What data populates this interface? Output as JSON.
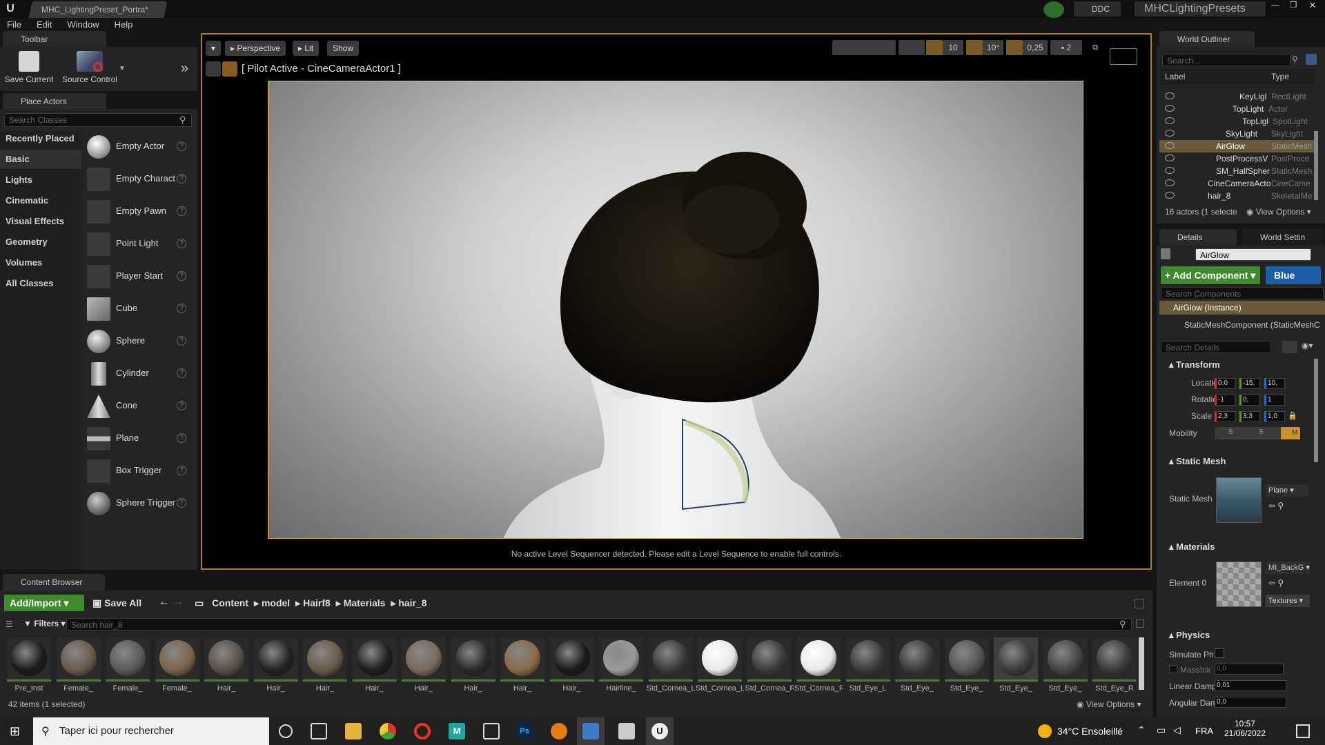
{
  "titlebar": {
    "doc_tab": "MHC_LightingPreset_Portra*",
    "ddc_label": "DDC",
    "project_name": "MHCLightingPresets"
  },
  "menu": [
    "File",
    "Edit",
    "Window",
    "Help"
  ],
  "toolbar": {
    "tab_label": "Toolbar",
    "save_current": "Save Current",
    "source_control": "Source Control"
  },
  "place_actors": {
    "tab_label": "Place Actors",
    "search_placeholder": "Search Classes",
    "categories": [
      "Recently Placed",
      "Basic",
      "Lights",
      "Cinematic",
      "Visual Effects",
      "Geometry",
      "Volumes",
      "All Classes"
    ],
    "active_category": "Basic",
    "actors": [
      "Empty Actor",
      "Empty Charact",
      "Empty Pawn",
      "Point Light",
      "Player Start",
      "Cube",
      "Sphere",
      "Cylinder",
      "Cone",
      "Plane",
      "Box Trigger",
      "Sphere Trigger"
    ]
  },
  "viewport": {
    "perspective": "Perspective",
    "lit": "Lit",
    "show": "Show",
    "pilot_label": "[ Pilot Active - CineCameraActor1 ]",
    "grid_snap": "10",
    "rot_snap": "10°",
    "scale_snap": "0,25",
    "cam_speed": "2",
    "sequencer_msg": "No active Level Sequencer detected. Please edit a Level Sequence to enable full controls."
  },
  "outliner": {
    "tab_label": "World Outliner",
    "search_placeholder": "Search...",
    "col_label": "Label",
    "col_type": "Type",
    "rows": [
      {
        "name": "KeyLigl",
        "type": "RectLight"
      },
      {
        "name": "TopLight",
        "type": "Actor"
      },
      {
        "name": "TopLigl",
        "type": "SpotLight"
      },
      {
        "name": "SkyLight",
        "type": "SkyLight"
      },
      {
        "name": "AirGlow",
        "type": "StaticMesh"
      },
      {
        "name": "PostProcessV",
        "type": "PostProce"
      },
      {
        "name": "SM_HalfSpher",
        "type": "StaticMesh"
      },
      {
        "name": "CineCameraActo",
        "type": "CineCame"
      },
      {
        "name": "hair_8",
        "type": "SkeletalMe"
      }
    ],
    "selected_row": "AirGlow",
    "status": "16 actors (1 selecte",
    "view_options": "View Options"
  },
  "details": {
    "tab_label": "Details",
    "world_settings_tab": "World Settin",
    "actor_name": "AirGlow",
    "add_component": "+ Add Component",
    "blueprint": "Blue",
    "search_components": "Search Components",
    "instance_label": "AirGlow (Instance)",
    "component_label": "StaticMeshComponent (StaticMeshC",
    "search_details": "Search Details",
    "transform": {
      "header": "Transform",
      "location_label": "Location",
      "rotation_label": "Rotation",
      "scale_label": "Scale",
      "mobility_label": "Mobility",
      "location": [
        "0,0",
        "-15,",
        "10,"
      ],
      "rotation": [
        "-1",
        "0,",
        "1"
      ],
      "scale": [
        "2,3",
        "3,3",
        "1,0"
      ],
      "mobility_options": [
        "S",
        "S",
        "M"
      ]
    },
    "static_mesh": {
      "header": "Static Mesh",
      "label": "Static Mesh",
      "value": "Plane"
    },
    "materials": {
      "header": "Materials",
      "element_label": "Element 0",
      "value": "MI_BackG",
      "textures": "Textures"
    },
    "physics": {
      "header": "Physics",
      "simulate": "Simulate Ph",
      "mass": "MassInk",
      "mass_value": "0,0",
      "linear_damping": "Linear Damp",
      "linear_value": "0,01",
      "angular_damping": "Angular Dam",
      "angular_value": "0,0"
    }
  },
  "content_browser": {
    "tab_label": "Content Browser",
    "add_import": "Add/Import",
    "save_all": "Save All",
    "path": [
      "Content",
      "model",
      "Hairf8",
      "Materials",
      "hair_8"
    ],
    "filters": "Filters",
    "search_placeholder": "Search hair_8",
    "assets": [
      "Pre_Inst",
      "Female_",
      "Female_",
      "Female_",
      "Hair_",
      "Hair_",
      "Hair_",
      "Hair_",
      "Hair_",
      "Hair_",
      "Hair_",
      "Hair_",
      "Hairline_",
      "Std_Cornea_L",
      "Std_Cornea_L",
      "Std_Cornea_R",
      "Std_Cornea_R",
      "Std_Eye_L",
      "Std_Eye_",
      "Std_Eye_",
      "Std_Eye_",
      "Std_Eye_",
      "Std_Eye_R"
    ],
    "status": "42 items (1 selected)",
    "view_options": "View Options"
  },
  "taskbar": {
    "search_placeholder": "Taper ici pour rechercher",
    "weather": "34°C Ensoleillé",
    "lang": "FRA",
    "time": "10:57",
    "date": "21/06/2022"
  }
}
